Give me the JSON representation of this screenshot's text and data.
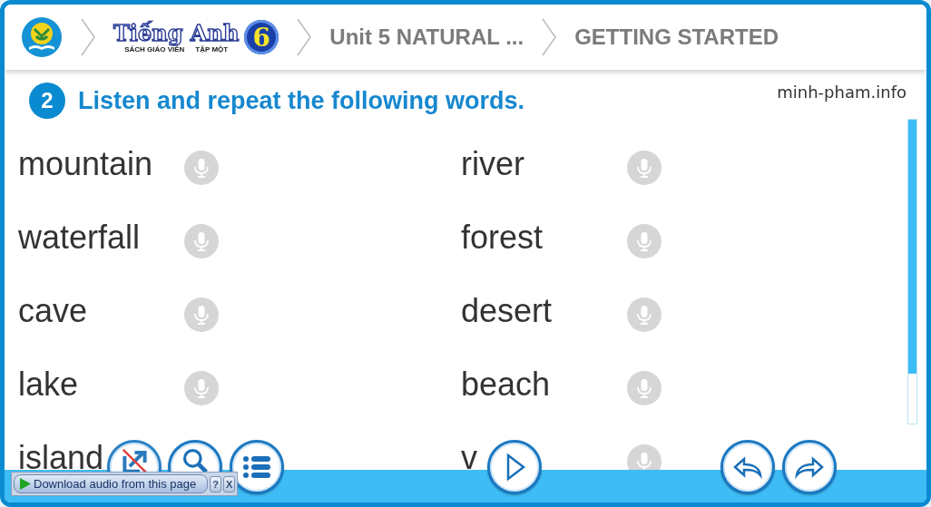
{
  "header": {
    "logo": {
      "title": "Tiếng Anh",
      "subtitle_left": "SÁCH GIÁO VIÊN",
      "subtitle_right": "TẬP MỘT",
      "grade": "6"
    },
    "breadcrumbs": [
      {
        "label": "Unit 5 NATURAL ..."
      },
      {
        "label": "GETTING STARTED"
      }
    ]
  },
  "exercise": {
    "number": "2",
    "instruction": "Listen and repeat the following words.",
    "credit": "minh-pham.info"
  },
  "words": [
    {
      "word": "mountain",
      "mic": true
    },
    {
      "word": "river",
      "mic": true
    },
    {
      "word": "waterfall",
      "mic": true
    },
    {
      "word": "forest",
      "mic": true
    },
    {
      "word": "cave",
      "mic": true
    },
    {
      "word": "desert",
      "mic": true
    },
    {
      "word": "lake",
      "mic": true
    },
    {
      "word": "beach",
      "mic": true
    },
    {
      "word": "island",
      "mic": false
    },
    {
      "word": "v",
      "mic": true
    }
  ],
  "toolbar": {
    "left_buttons": [
      {
        "kind": "share",
        "disabled": true
      },
      {
        "kind": "search",
        "disabled": false
      },
      {
        "kind": "menu",
        "disabled": false
      }
    ],
    "center_buttons": [
      {
        "kind": "play",
        "disabled": false
      }
    ],
    "right_buttons": [
      {
        "kind": "back",
        "disabled": false
      },
      {
        "kind": "forward",
        "disabled": false
      }
    ]
  },
  "download_bar": {
    "label": "Download audio from this page",
    "help": "?",
    "close": "X"
  }
}
